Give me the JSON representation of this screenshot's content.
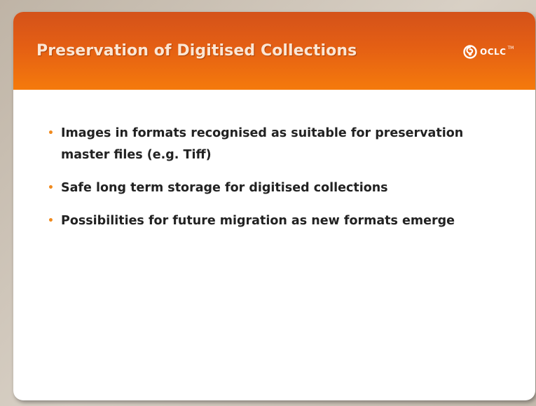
{
  "slide": {
    "title": "Preservation of Digitised Collections",
    "logo": {
      "text": "OCLC",
      "tm": "TM",
      "icon": "oclc-logo-icon"
    },
    "bullets": [
      {
        "text": "Images in formats recognised as suitable for preservation master files (e.g. Tiff)"
      },
      {
        "text": "Safe long term storage for digitised collections"
      },
      {
        "text": "Possibilities for future migration as new formats emerge"
      }
    ],
    "bullet_glyph": "•"
  },
  "colors": {
    "header_top": "#d4521a",
    "header_bottom": "#f57a0c",
    "title_text": "#fbe6d4",
    "bullet_accent": "#f08a1e",
    "body_text": "#222222",
    "background": "#cfc6ba"
  }
}
